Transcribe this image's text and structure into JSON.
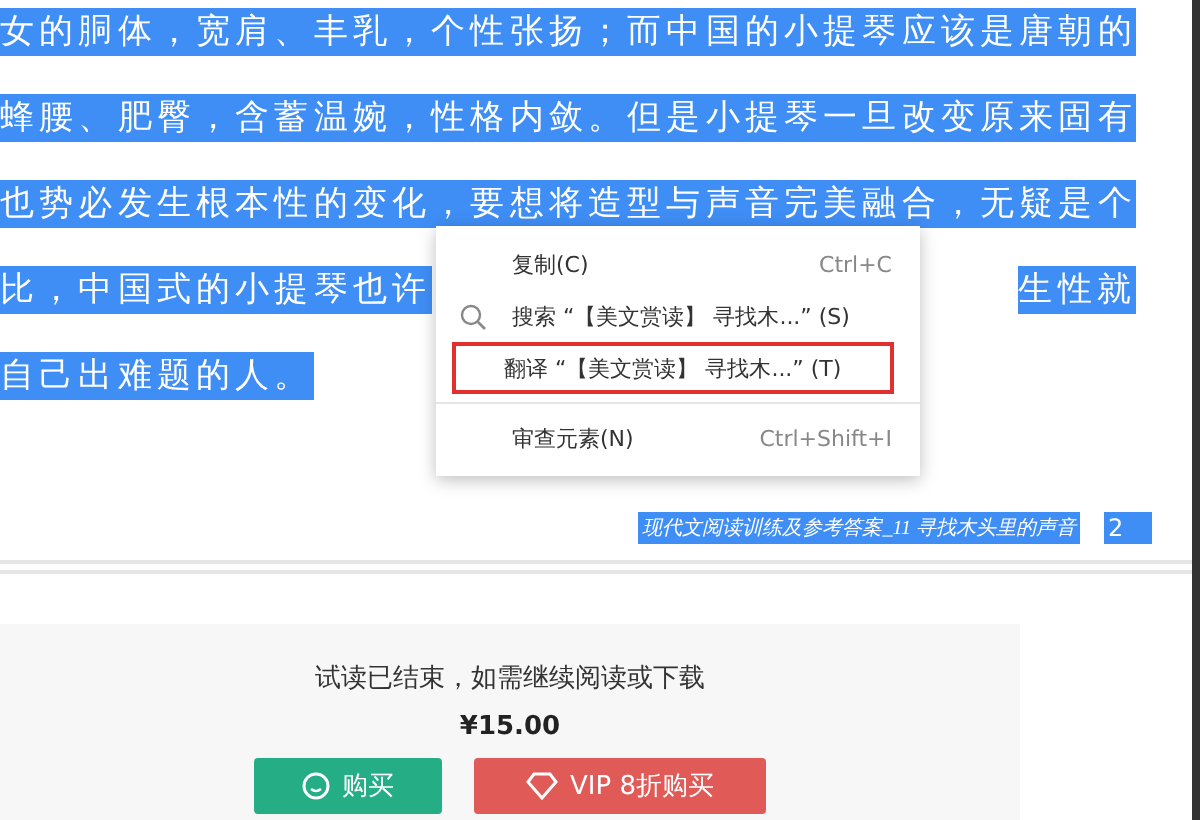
{
  "article": {
    "lines": [
      {
        "segments": [
          "女的胴体，宽肩、丰乳，个性张扬；而中国的小提琴应该是唐朝的"
        ]
      },
      {
        "segments": [
          "蜂腰、肥臀，含蓄温婉，性格内敛。但是小提琴一旦改变原来固有"
        ]
      },
      {
        "segments": [
          "也势必发生根本性的变化，要想将造型与声音完美融合，无疑是个"
        ]
      },
      {
        "segments": [
          "比，中国式的小提琴也许",
          "生性就"
        ]
      },
      {
        "segments": [
          "自己出难题的人。"
        ]
      }
    ],
    "footer_title": "现代文阅读训练及参考答案_11 寻找木头里的声音",
    "page_number": "2"
  },
  "context_menu": {
    "items": [
      {
        "kind": "command",
        "label": "复制(C)",
        "shortcut": "Ctrl+C",
        "highlighted": false
      },
      {
        "kind": "search",
        "label": "搜索 “【美文赏读】 寻找木...” (S)",
        "highlighted": false
      },
      {
        "kind": "command",
        "label": "翻译 “【美文赏读】 寻找木...” (T)",
        "highlighted": true
      },
      {
        "kind": "separator"
      },
      {
        "kind": "command",
        "label": "审查元素(N)",
        "shortcut": "Ctrl+Shift+I",
        "highlighted": false
      }
    ]
  },
  "paywall": {
    "message": "试读已结束，如需继续阅读或下载",
    "price": "¥15.00",
    "buttons": [
      {
        "kind": "buy",
        "label": "购买"
      },
      {
        "kind": "vip",
        "label": "VIP 8折购买"
      }
    ]
  }
}
